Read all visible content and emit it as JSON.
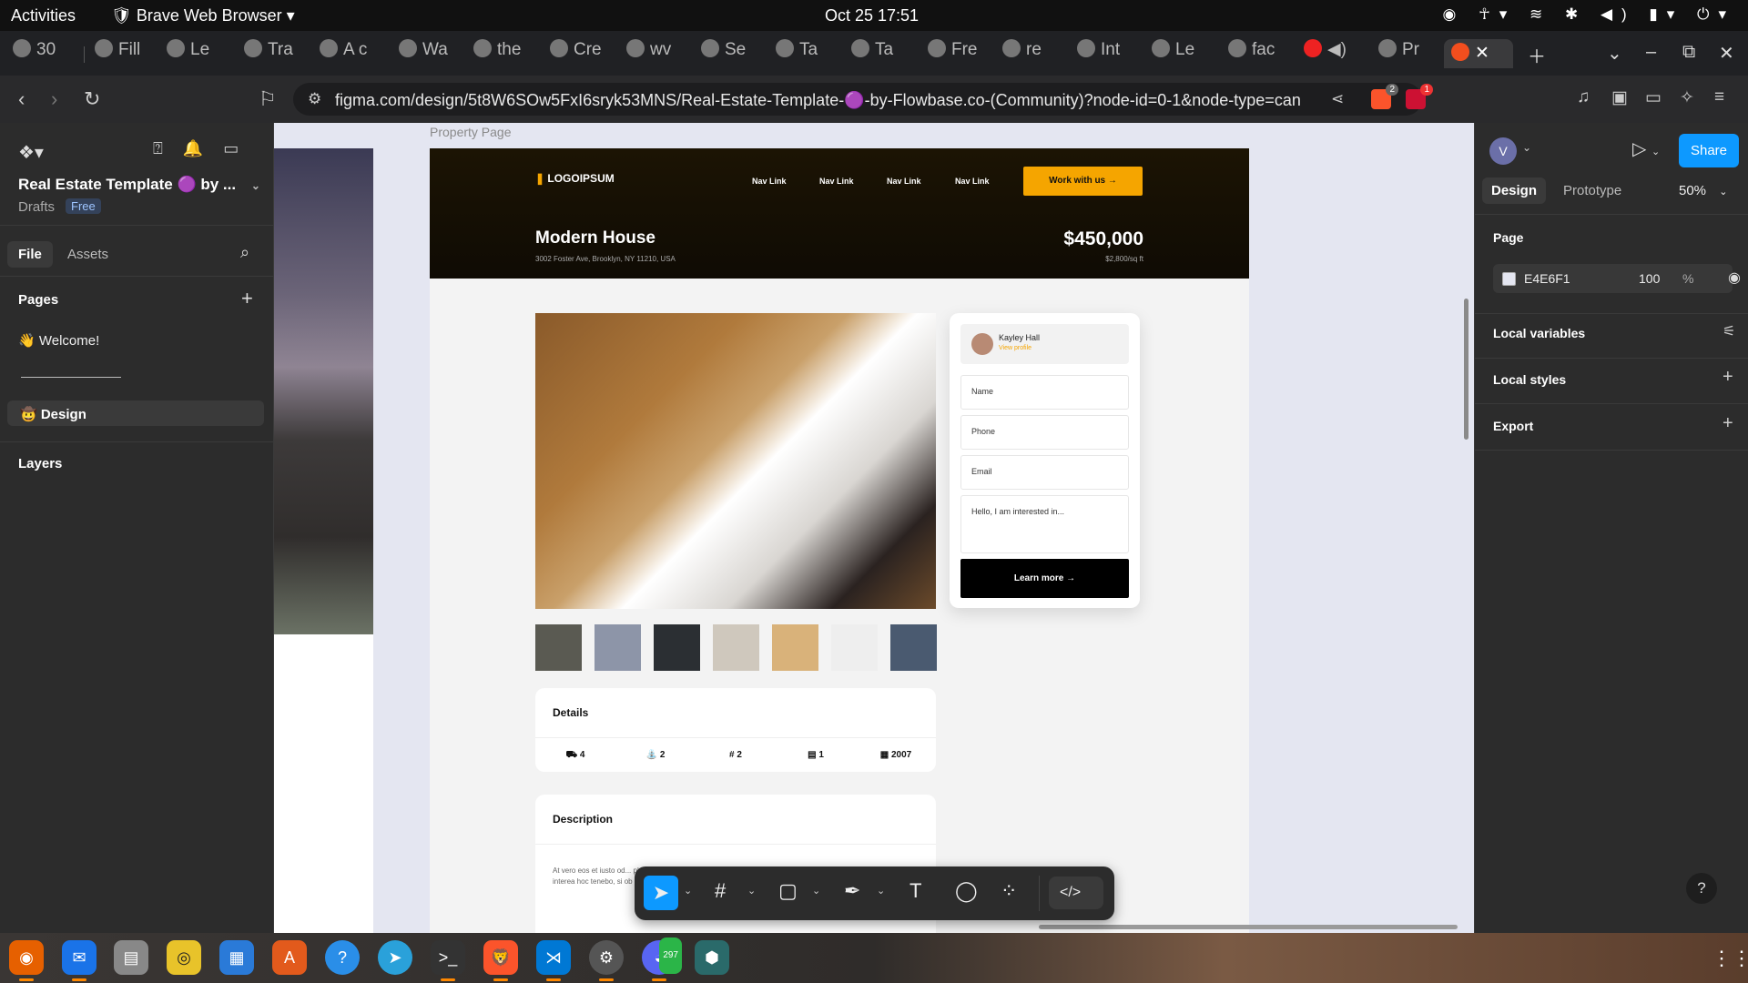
{
  "system_bar": {
    "activities": "Activities",
    "app_name": "Brave Web Browser",
    "clock": "Oct 25  17:51"
  },
  "tabs": [
    {
      "label": "30"
    },
    {
      "label": "Fill"
    },
    {
      "label": "Le"
    },
    {
      "label": "Tra"
    },
    {
      "label": "A c"
    },
    {
      "label": "Wa"
    },
    {
      "label": "the"
    },
    {
      "label": "Cre"
    },
    {
      "label": "wv"
    },
    {
      "label": "Se"
    },
    {
      "label": "Ta"
    },
    {
      "label": "Ta"
    },
    {
      "label": "Fre"
    },
    {
      "label": "re"
    },
    {
      "label": "Int"
    },
    {
      "label": "Le"
    },
    {
      "label": "fac"
    },
    {
      "label": ""
    },
    {
      "label": "Pr"
    },
    {
      "label": ""
    }
  ],
  "address_bar": {
    "url": "figma.com/design/5t8W6SOw5FxI6sryk53MNS/Real-Estate-Template-🟣-by-Flowbase.co-(Community)?node-id=0-1&node-type=canva...",
    "shield_count": "2",
    "alert_count": "1"
  },
  "left_panel": {
    "project_name": "Real Estate Template 🟣 by ...",
    "drafts": "Drafts",
    "plan_badge": "Free",
    "tab_file": "File",
    "tab_assets": "Assets",
    "pages_header": "Pages",
    "pages": [
      "👋 Welcome!",
      "🤠 Design"
    ],
    "layers_header": "Layers"
  },
  "canvas": {
    "frame_label": "Property Page",
    "site": {
      "logo": "LOGOIPSUM",
      "nav_links": [
        "Nav Link",
        "Nav Link",
        "Nav Link",
        "Nav Link"
      ],
      "cta": "Work with us →",
      "title": "Modern House",
      "address": "3002 Foster Ave, Brooklyn, NY 11210, USA",
      "price": "$450,000",
      "price_per_sqft": "$2,800/sq ft",
      "agent_name": "Kayley Hall",
      "agent_link": "View profile",
      "form_fields": [
        "Name",
        "Phone",
        "Email",
        "Hello, I am interested in..."
      ],
      "learn_more": "Learn more  →",
      "details_title": "Details",
      "details": [
        {
          "icon": "bed-icon",
          "value": "4"
        },
        {
          "icon": "bath-icon",
          "value": "2"
        },
        {
          "icon": "area-icon",
          "value": "2"
        },
        {
          "icon": "building-icon",
          "value": "1"
        },
        {
          "icon": "calendar-icon",
          "value": "2007"
        }
      ],
      "description_title": "Description",
      "description_text": "At vero eos et iusto od... placet: constituam, q... nam libero tempore, c... Si sine metu degendae p... quy videro: interea hoc tenebo, si ob rem voluptas assumenda est, quid sit interer et inter"
    }
  },
  "toolbar": {
    "tools": [
      "move-tool",
      "frame-tool",
      "rectangle-tool",
      "pen-tool",
      "text-tool",
      "comment-tool",
      "components-tool"
    ],
    "dev_mode": "</>"
  },
  "right_panel": {
    "avatar_letter": "V",
    "share": "Share",
    "tab_design": "Design",
    "tab_prototype": "Prototype",
    "zoom": "50%",
    "page_section": "Page",
    "page_color": "E4E6F1",
    "page_opacity": "100",
    "percent": "%",
    "local_variables": "Local variables",
    "local_styles": "Local styles",
    "export": "Export",
    "help": "?"
  },
  "taskbar": {
    "discord_badge": "297"
  },
  "colors": {
    "accent": "#0d99ff",
    "site_accent": "#f5a500",
    "canvas_bg": "#e4e6f1"
  }
}
